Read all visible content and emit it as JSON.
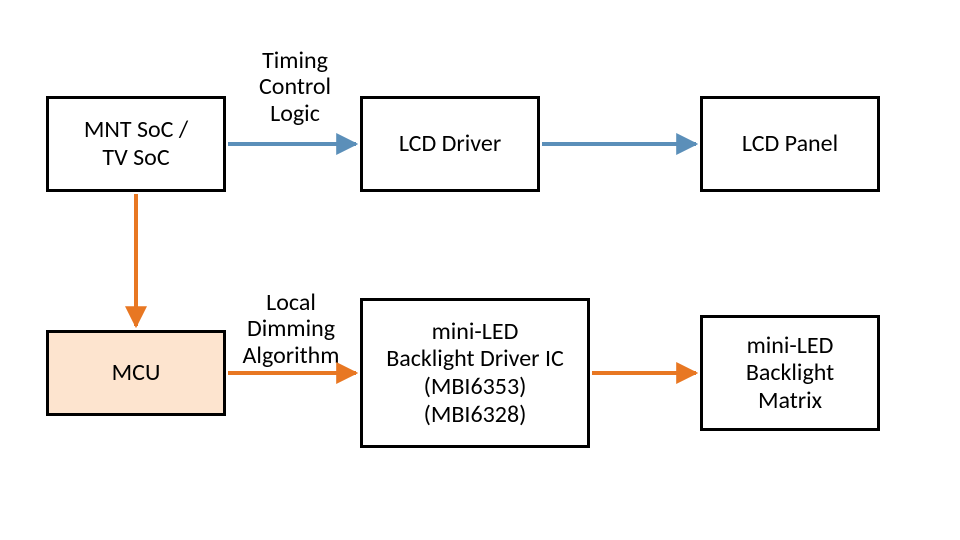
{
  "diagram": {
    "nodes": {
      "soc": {
        "label": "MNT SoC /\nTV SoC"
      },
      "lcd_driver": {
        "label": "LCD Driver"
      },
      "lcd_panel": {
        "label": "LCD Panel"
      },
      "mcu": {
        "label": "MCU"
      },
      "bl_driver": {
        "label": "mini-LED\nBacklight Driver IC\n(MBI6353)\n(MBI6328)"
      },
      "bl_matrix": {
        "label": "mini-LED\nBacklight\nMatrix"
      }
    },
    "edges": {
      "timing_control_logic": {
        "label": "Timing\nControl\nLogic",
        "from": "soc",
        "to": "lcd_driver",
        "color": "blue"
      },
      "lcd_driver_to_panel": {
        "label": "",
        "from": "lcd_driver",
        "to": "lcd_panel",
        "color": "blue"
      },
      "soc_to_mcu": {
        "label": "",
        "from": "soc",
        "to": "mcu",
        "color": "orange"
      },
      "local_dimming_algorithm": {
        "label": "Local\nDimming\nAlgorithm",
        "from": "mcu",
        "to": "bl_driver",
        "color": "orange"
      },
      "bl_driver_to_matrix": {
        "label": "",
        "from": "bl_driver",
        "to": "bl_matrix",
        "color": "orange"
      }
    },
    "colors": {
      "blue": "#5B8FB9",
      "orange": "#E87722"
    }
  }
}
